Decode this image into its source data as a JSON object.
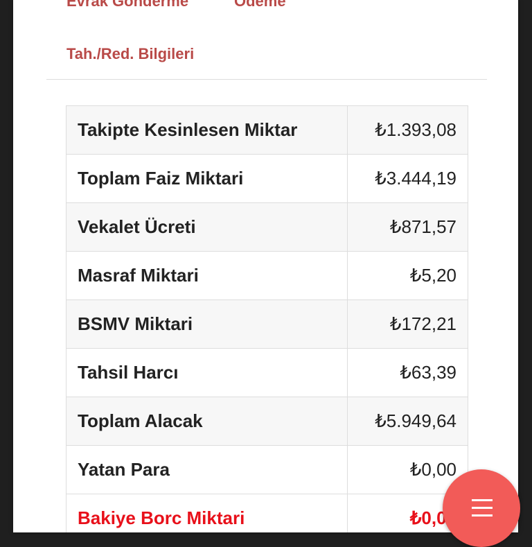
{
  "nav": {
    "evrak_gonderme": "Evrak Gönderme",
    "odeme": "Ödeme",
    "tah_red_bilgileri": "Tah./Red. Bilgileri"
  },
  "summary": {
    "rows": [
      {
        "label": "Takipte Kesinlesen Miktar",
        "value": "₺1.393,08"
      },
      {
        "label": "Toplam Faiz Miktari",
        "value": "₺3.444,19"
      },
      {
        "label": "Vekalet Ücreti",
        "value": "₺871,57"
      },
      {
        "label": "Masraf Miktari",
        "value": "₺5,20"
      },
      {
        "label": "BSMV Miktari",
        "value": "₺172,21"
      },
      {
        "label": "Tahsil Harcı",
        "value": "₺63,39"
      },
      {
        "label": "Toplam Alacak",
        "value": "₺5.949,64"
      },
      {
        "label": "Yatan Para",
        "value": "₺0,00"
      },
      {
        "label": "Bakiye Borc Miktari",
        "value": "₺0,00"
      }
    ]
  },
  "fab": {
    "icon": "menu-icon"
  },
  "colors": {
    "link": "#b94a48",
    "highlight": "#e8101a",
    "fab": "#f25b58"
  }
}
